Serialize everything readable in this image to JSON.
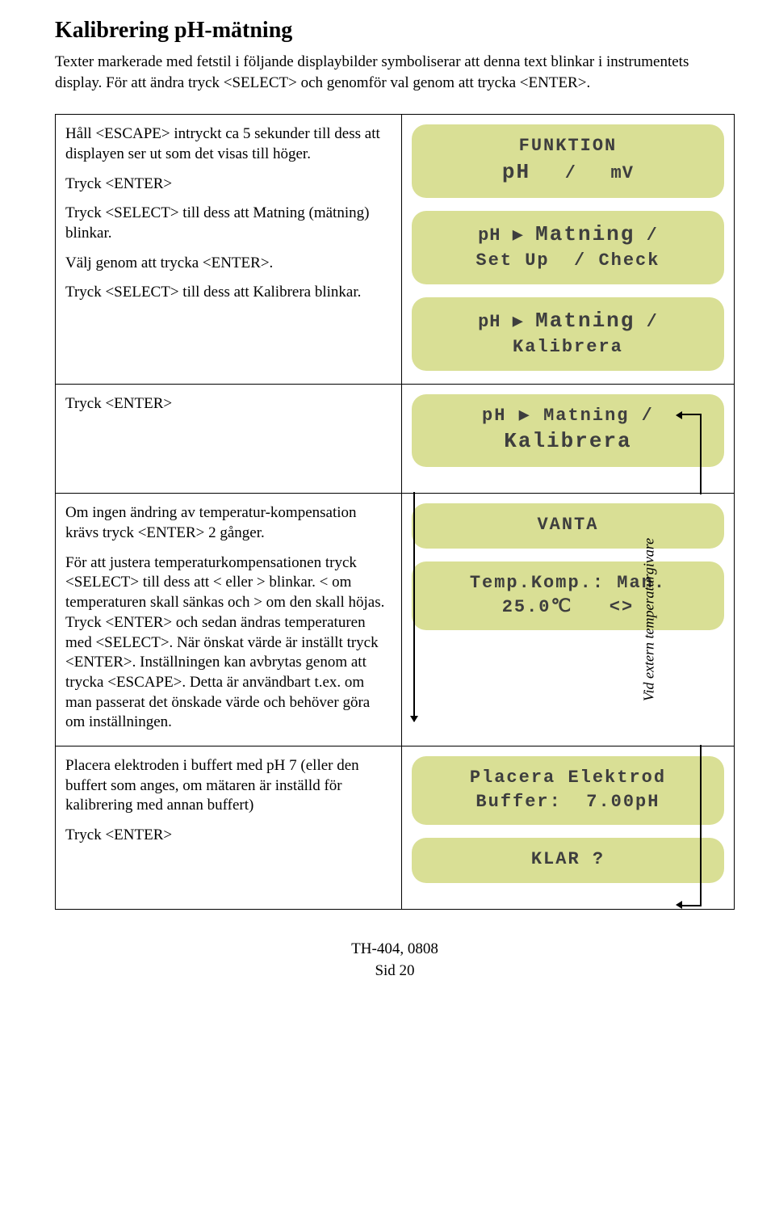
{
  "heading": "Kalibrering pH-mätning",
  "intro": "Texter markerade med fetstil i följande displaybilder symboliserar att denna text blinkar i instrumentets display. För att ändra tryck <SELECT> och genomför val genom att trycka <ENTER>.",
  "rows": [
    {
      "instr": [
        "Håll <ESCAPE> intryckt ca 5 sekunder till dess att displayen ser ut som det visas till höger.",
        "Tryck <ENTER>",
        "Tryck <SELECT> till dess att Matning (mätning) blinkar.",
        "Välj genom att trycka <ENTER>.",
        "Tryck <SELECT> till dess att Kalibrera blinkar."
      ],
      "lcds": [
        {
          "lines": [
            "FUNKTION",
            "pH   /   mV"
          ],
          "hlIndex": 1,
          "hlWord": "pH"
        },
        {
          "lines": [
            "pH ▶ Matning /",
            "Set Up  / Check"
          ],
          "hlIndex": 0,
          "hlWord": "Matning"
        },
        {
          "lines": [
            "pH ▶ Matning /",
            "Kalibrera"
          ],
          "hlIndex": 0,
          "hlWord": "Matning"
        }
      ]
    },
    {
      "instr": [
        "Tryck <ENTER>"
      ],
      "lcds": [
        {
          "lines": [
            "pH ▶ Matning /",
            "Kalibrera"
          ],
          "hlIndex": 1,
          "hlWord": "Kalibrera"
        }
      ],
      "connA": true
    },
    {
      "instr": [
        "Om ingen ändring av temperatur-kompensation krävs tryck <ENTER> 2 gånger.",
        "För att justera temperaturkompensationen tryck <SELECT> till dess att < eller > blinkar. < om temperaturen skall sänkas och > om den skall höjas. Tryck <ENTER> och sedan ändras temperaturen med <SELECT>. När önskat värde är inställt tryck <ENTER>. Inställningen kan avbrytas genom att trycka <ESCAPE>. Detta är användbart t.ex. om man passerat det önskade värde och behöver göra om inställningen."
      ],
      "lcds": [
        {
          "lines": [
            "VANTA"
          ]
        },
        {
          "lines": [
            "Temp.Komp.: Man.",
            "25.0℃   <>"
          ]
        }
      ],
      "sideLabel": "Vid extern temperaturgivare",
      "connC": true
    },
    {
      "instr": [
        "Placera elektroden i buffert med pH 7 (eller den buffert som anges, om mätaren är inställd för kalibrering med annan buffert)",
        "Tryck <ENTER>"
      ],
      "lcds": [
        {
          "lines": [
            "Placera Elektrod",
            "Buffer:  7.00pH"
          ]
        },
        {
          "lines": [
            "KLAR ?"
          ]
        }
      ],
      "connB": true
    }
  ],
  "footer": {
    "doc": "TH-404, 0808",
    "page": "Sid 20"
  }
}
